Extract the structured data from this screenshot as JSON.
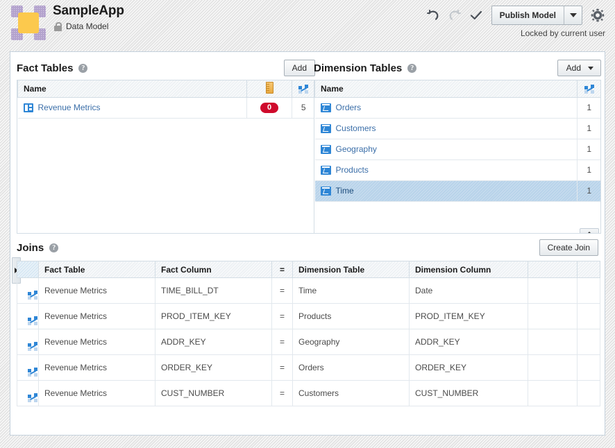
{
  "header": {
    "app_name": "SampleApp",
    "subtitle": "Data Model",
    "lock_icon": "lock-icon",
    "locked_note": "Locked by current user",
    "undo_icon": "undo-icon",
    "redo_icon": "redo-icon",
    "check_icon": "check-icon",
    "gear_icon": "gear-icon",
    "publish_label": "Publish Model",
    "publish_caret_icon": "chevron-down-icon",
    "accent_color": "#2e86d6",
    "logo_color": "#b3a2cd",
    "logo_center_color": "#fcc94d"
  },
  "fact_tables": {
    "title": "Fact Tables",
    "help_icon": "help-icon",
    "add_label": "Add",
    "columns": {
      "name": "Name",
      "measure_icon": "ruler-icon",
      "join_icon": "join-icon"
    },
    "rows": [
      {
        "icon": "fact-table-icon",
        "name": "Revenue Metrics",
        "measures": "0",
        "joins": "5",
        "measures_badge_color": "#cf0a2c"
      }
    ]
  },
  "dimension_tables": {
    "title": "Dimension Tables",
    "help_icon": "help-icon",
    "add_label": "Add",
    "add_caret_icon": "chevron-down-icon",
    "columns": {
      "name": "Name",
      "join_icon": "join-icon"
    },
    "rows": [
      {
        "icon": "dimension-table-icon",
        "name": "Orders",
        "joins": "1",
        "selected": false
      },
      {
        "icon": "dimension-table-icon",
        "name": "Customers",
        "joins": "1",
        "selected": false
      },
      {
        "icon": "dimension-table-icon",
        "name": "Geography",
        "joins": "1",
        "selected": false
      },
      {
        "icon": "dimension-table-icon",
        "name": "Products",
        "joins": "1",
        "selected": false
      },
      {
        "icon": "dimension-table-icon",
        "name": "Time",
        "joins": "1",
        "selected": true
      }
    ],
    "scroll_nub_icon": "scroll-up-icon"
  },
  "joins": {
    "title": "Joins",
    "help_icon": "help-icon",
    "create_label": "Create Join",
    "columns": {
      "icon": "",
      "fact_table": "Fact Table",
      "fact_column": "Fact Column",
      "equals": "=",
      "dimension_table": "Dimension Table",
      "dimension_column": "Dimension Column",
      "extra1": "",
      "extra2": ""
    },
    "rows": [
      {
        "icon": "join-icon",
        "fact_table": "Revenue Metrics",
        "fact_column": "TIME_BILL_DT",
        "equals": "=",
        "dimension_table": "Time",
        "dimension_column": "Date"
      },
      {
        "icon": "join-icon",
        "fact_table": "Revenue Metrics",
        "fact_column": "PROD_ITEM_KEY",
        "equals": "=",
        "dimension_table": "Products",
        "dimension_column": "PROD_ITEM_KEY"
      },
      {
        "icon": "join-icon",
        "fact_table": "Revenue Metrics",
        "fact_column": "ADDR_KEY",
        "equals": "=",
        "dimension_table": "Geography",
        "dimension_column": "ADDR_KEY"
      },
      {
        "icon": "join-icon",
        "fact_table": "Revenue Metrics",
        "fact_column": "ORDER_KEY",
        "equals": "=",
        "dimension_table": "Orders",
        "dimension_column": "ORDER_KEY"
      },
      {
        "icon": "join-icon",
        "fact_table": "Revenue Metrics",
        "fact_column": "CUST_NUMBER",
        "equals": "=",
        "dimension_table": "Customers",
        "dimension_column": "CUST_NUMBER"
      }
    ]
  },
  "collapse_handle_icon": "expand-right-icon"
}
